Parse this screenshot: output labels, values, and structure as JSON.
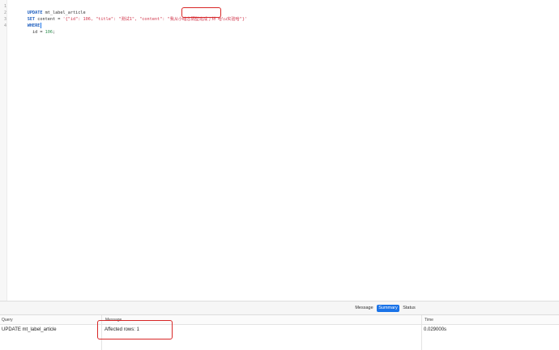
{
  "editor": {
    "line_numbers": [
      "1",
      "2",
      "3",
      "4"
    ],
    "line1": {
      "kw": "UPDATE",
      "rest": " mt_label_article"
    },
    "line2": {
      "kw": "SET",
      "before": " content = ",
      "string": "'{\"id\": 106, \"title\": \"测试1\", \"content\": \"我从小暗恋隔壁班成了绊",
      "highlighted": "哈\\u实验哈\"}'"
    },
    "line3": {
      "kw": "WHERE"
    },
    "line4": {
      "field": "  id = ",
      "value": "106",
      "end": ";"
    }
  },
  "tabs": {
    "message": "Message",
    "summary": "Summary",
    "status": "Status",
    "active": "Summary"
  },
  "result": {
    "columns": {
      "query": "Query",
      "message": "Message",
      "time": "Time"
    },
    "rows": [
      {
        "query": "UPDATE mt_label_article",
        "message": "Affected rows: 1",
        "time": "0.029000s"
      }
    ]
  },
  "colors": {
    "keyword": "#1f5fbf",
    "string": "#d0344a",
    "number": "#2f8f4f",
    "highlight_box": "#d82626",
    "active_tab": "#1a73e8"
  }
}
